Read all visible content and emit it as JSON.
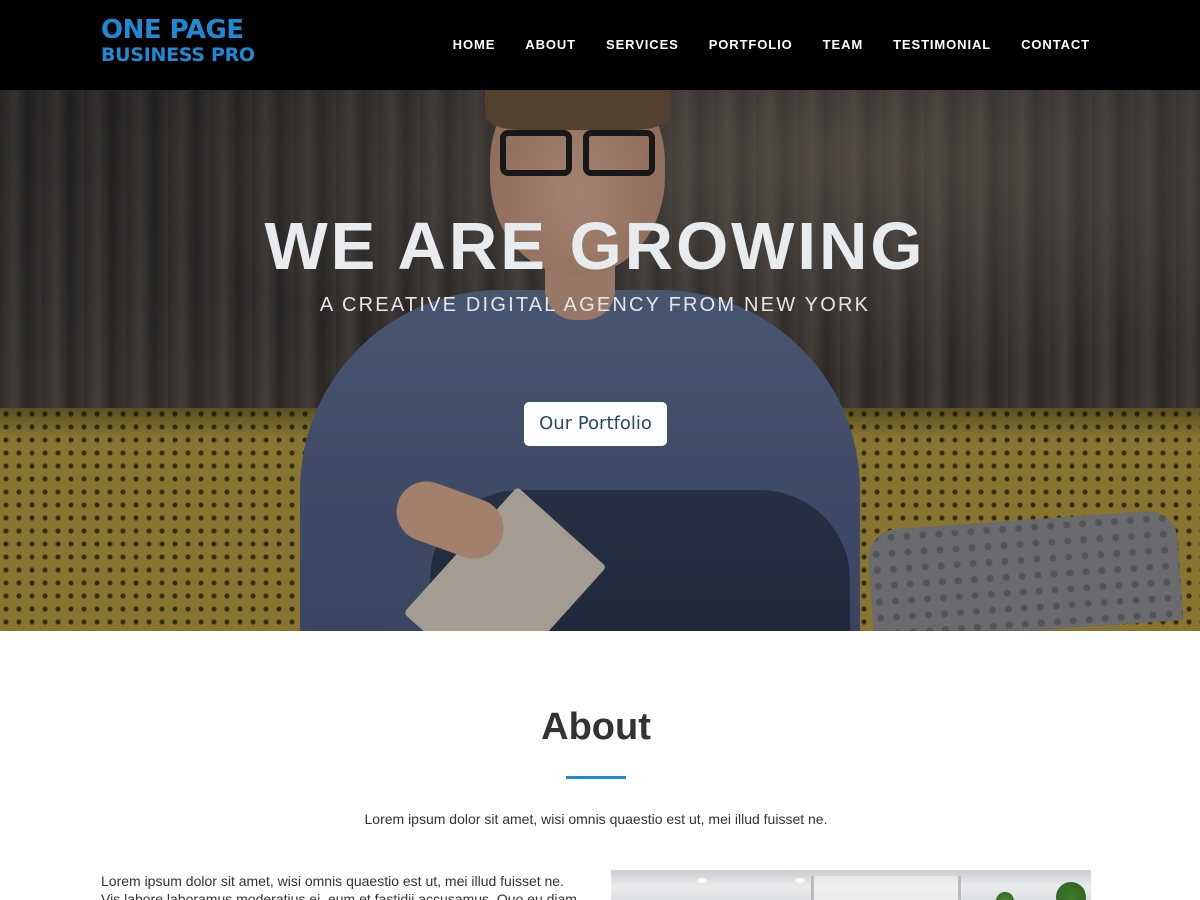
{
  "header": {
    "logo_line1": "ONE PAGE",
    "logo_line2": "BUSINESS PRO",
    "nav": [
      "HOME",
      "ABOUT",
      "SERVICES",
      "PORTFOLIO",
      "TEAM",
      "TESTIMONIAL",
      "CONTACT"
    ]
  },
  "hero": {
    "title": "WE ARE GROWING",
    "subtitle": "A CREATIVE DIGITAL AGENCY FROM NEW YORK",
    "button_label": "Our Portfolio"
  },
  "about": {
    "title": "About",
    "intro": "Lorem ipsum dolor sit amet, wisi omnis quaestio est ut, mei illud fuisset ne.",
    "body": "Lorem ipsum dolor sit amet, wisi omnis quaestio est ut, mei illud fuisset ne. Vis labore laboramus moderatius ei, eum et fastidii accusamus. Quo eu diam"
  },
  "colors": {
    "accent": "#1e8ad6",
    "header_bg": "#000000"
  }
}
